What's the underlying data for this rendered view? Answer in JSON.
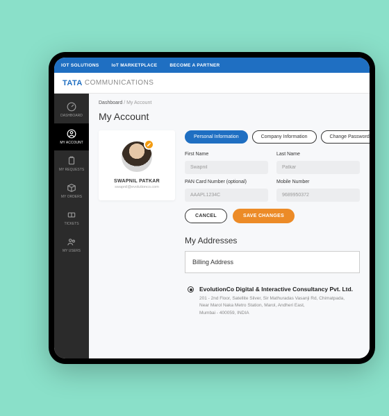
{
  "topnav": {
    "items": [
      "IOT SOLUTIONS",
      "IoT MARKETPLACE",
      "BECOME A PARTNER"
    ]
  },
  "brand": {
    "tata": "TATA",
    "comm": "COMMUNICATIONS"
  },
  "sidebar": {
    "items": [
      {
        "label": "DASHBOARD"
      },
      {
        "label": "MY ACCOUNT"
      },
      {
        "label": "MY REQUESTS"
      },
      {
        "label": "MY ORDERS"
      },
      {
        "label": "TICKETS"
      },
      {
        "label": "MY USERS"
      }
    ]
  },
  "breadcrumb": {
    "root": "Dashboard",
    "sep": " / ",
    "current": "My Account"
  },
  "page_title": "My Account",
  "profile": {
    "name": "SWAPNIL PATKAR",
    "email": "swapnil@evolutionco.com"
  },
  "tabs": {
    "personal": "Personal Information",
    "company": "Company Information",
    "password": "Change Password"
  },
  "form": {
    "first_name_label": "First Name",
    "first_name_value": "Swapnil",
    "last_name_label": "Last Name",
    "last_name_value": "Patkar",
    "pan_label": "PAN Card Number (optional)",
    "pan_value": "AAAPL1234C",
    "mobile_label": "Mobile Number",
    "mobile_value": "9689950372",
    "cancel": "CANCEL",
    "save": "SAVE CHANGES"
  },
  "addresses": {
    "section_title": "My Addresses",
    "billing_label": "Billing Address",
    "selected": {
      "title": "EvolutionCo Digital & Interactive Consultancy Pvt. Ltd.",
      "line1": "201 - 2nd Floor, Satellite Silver, Sir Mathuradas Vasanji Rd, Chimatpada,",
      "line2": "Near Marol Naka Metro Station, Marol, Andheri East,",
      "line3": "Mumbai - 400059, INDIA"
    }
  }
}
